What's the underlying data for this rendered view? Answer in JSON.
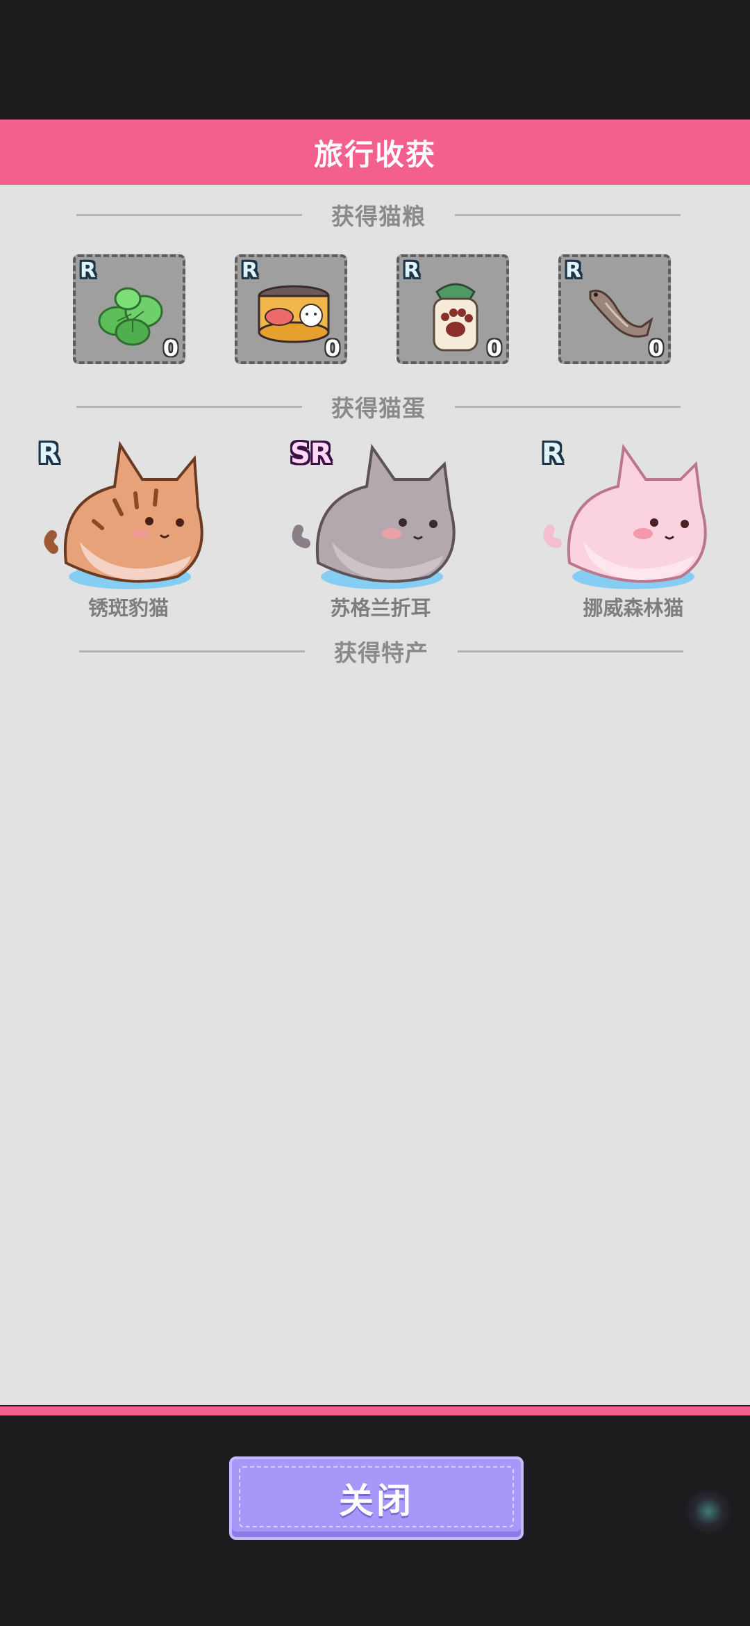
{
  "header": {
    "title": "旅行收获"
  },
  "sections": {
    "food": "获得猫粮",
    "eggs": "获得猫蛋",
    "specialty": "获得特产"
  },
  "food_items": [
    {
      "name": "mint-leaves",
      "rarity": "R",
      "count": "0"
    },
    {
      "name": "canned-fish",
      "rarity": "R",
      "count": "0"
    },
    {
      "name": "paw-jar",
      "rarity": "R",
      "count": "0"
    },
    {
      "name": "dried-fish",
      "rarity": "R",
      "count": "0"
    }
  ],
  "cats": [
    {
      "rarity": "R",
      "name": "锈斑豹猫"
    },
    {
      "rarity": "SR",
      "name": "苏格兰折耳"
    },
    {
      "rarity": "R",
      "name": "挪威森林猫"
    }
  ],
  "footer": {
    "close_label": "关闭"
  },
  "colors": {
    "accent_pink": "#f3608e",
    "panel": "#e2e2e2",
    "button": "#a896f8",
    "backdrop": "#1c1c1e"
  }
}
